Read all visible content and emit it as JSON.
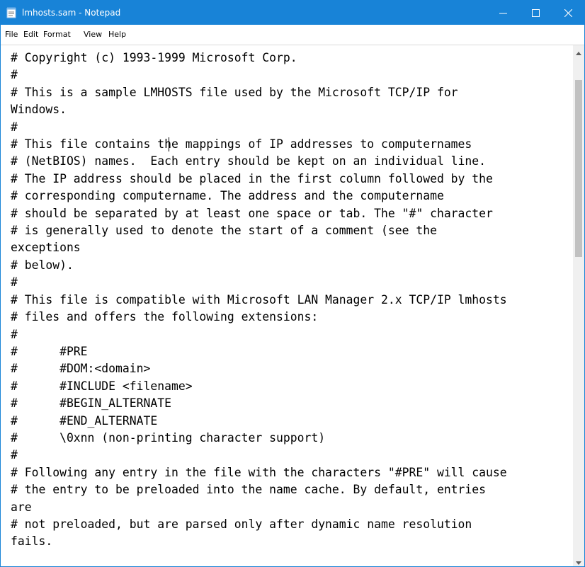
{
  "window": {
    "title": "lmhosts.sam - Notepad",
    "accent_color": "#1883d7",
    "icon": "notepad-icon",
    "controls": [
      "minimize-icon",
      "maximize-icon",
      "close-icon"
    ]
  },
  "menu": {
    "file": "File",
    "edit": "Edit",
    "format": "Format",
    "view": "View",
    "help": "Help"
  },
  "editor": {
    "content": "# Copyright (c) 1993-1999 Microsoft Corp.\n#\n# This is a sample LMHOSTS file used by the Microsoft TCP/IP for\nWindows.\n#\n# This file contains the mappings of IP addresses to computernames\n# (NetBIOS) names.  Each entry should be kept on an individual line.\n# The IP address should be placed in the first column followed by the\n# corresponding computername. The address and the computername\n# should be separated by at least one space or tab. The \"#\" character\n# is generally used to denote the start of a comment (see the\nexceptions\n# below).\n#\n# This file is compatible with Microsoft LAN Manager 2.x TCP/IP lmhosts\n# files and offers the following extensions:\n#\n#      #PRE\n#      #DOM:<domain>\n#      #INCLUDE <filename>\n#      #BEGIN_ALTERNATE\n#      #END_ALTERNATE\n#      \\0xnn (non-printing character support)\n#\n# Following any entry in the file with the characters \"#PRE\" will cause\n# the entry to be preloaded into the name cache. By default, entries\nare\n# not preloaded, but are parsed only after dynamic name resolution\nfails."
  }
}
